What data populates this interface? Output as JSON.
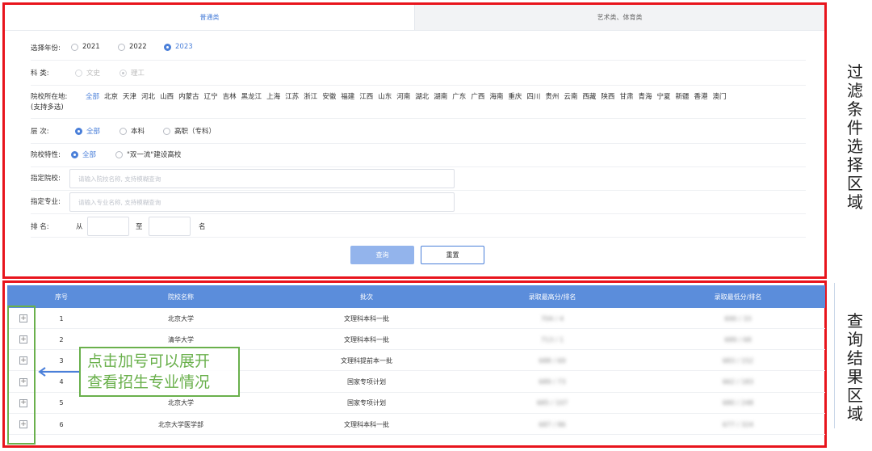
{
  "tabs": [
    {
      "label": "普通类",
      "active": true
    },
    {
      "label": "艺术类、体育类",
      "active": false
    }
  ],
  "year": {
    "label": "选择年份:",
    "options": [
      "2021",
      "2022",
      "2023"
    ],
    "selected": "2023"
  },
  "subject": {
    "label": "科    类:",
    "options": [
      "文史",
      "理工"
    ],
    "selected": "理工"
  },
  "region": {
    "label": "院校所在地:",
    "label2": "(支持多选)",
    "options": [
      "全部",
      "北京",
      "天津",
      "河北",
      "山西",
      "内蒙古",
      "辽宁",
      "吉林",
      "黑龙江",
      "上海",
      "江苏",
      "浙江",
      "安徽",
      "福建",
      "江西",
      "山东",
      "河南",
      "湖北",
      "湖南",
      "广东",
      "广西",
      "海南",
      "重庆",
      "四川",
      "贵州",
      "云南",
      "西藏",
      "陕西",
      "甘肃",
      "青海",
      "宁夏",
      "新疆",
      "香港",
      "澳门"
    ]
  },
  "level": {
    "label": "层    次:",
    "options": [
      "全部",
      "本科",
      "高职（专科）"
    ],
    "selected": "全部"
  },
  "feature": {
    "label": "院校特性:",
    "options": [
      "全部",
      "\"双一流\"建设高校"
    ],
    "selected": "全部"
  },
  "school": {
    "label": "指定院校:",
    "placeholder": "请输入院校名称, 支持模糊查询"
  },
  "major": {
    "label": "指定专业:",
    "placeholder": "请输入专业名称, 支持模糊查询"
  },
  "rank": {
    "label": "排    名:",
    "from": "从",
    "to": "至",
    "suffix": "名"
  },
  "buttons": {
    "query": "查询",
    "reset": "重置"
  },
  "table": {
    "headers": [
      "序号",
      "院校名称",
      "批次",
      "录取最高分/排名",
      "录取最低分/排名"
    ],
    "rows": [
      {
        "no": "1",
        "name": "北京大学",
        "batch": "文理科本科一批",
        "max": "704 / 4",
        "min": "690 / 33"
      },
      {
        "no": "2",
        "name": "清华大学",
        "batch": "文理科本科一批",
        "max": "713 / 1",
        "min": "689 / 68"
      },
      {
        "no": "3",
        "name": "",
        "batch": "文理科提前本一批",
        "max": "688 / 69",
        "min": "683 / 152"
      },
      {
        "no": "4",
        "name": "",
        "batch": "国家专项计划",
        "max": "689 / 73",
        "min": "662 / 183"
      },
      {
        "no": "5",
        "name": "北京大学",
        "batch": "国家专项计划",
        "max": "685 / 107",
        "min": "680 / 248"
      },
      {
        "no": "6",
        "name": "北京大学医学部",
        "batch": "文理科本科一批",
        "max": "687 / 86",
        "min": "677 / 324"
      }
    ]
  },
  "annotations": {
    "callout_line1": "点击加号可以展开",
    "callout_line2": "查看招生专业情况",
    "filter_label": "过滤条件选择区域",
    "result_label": "查询结果区域"
  },
  "colors": {
    "highlight_border": "#e8141c",
    "accent": "#4a7fd9",
    "callout": "#6ab04c",
    "header_bg": "#5b8ddb"
  }
}
